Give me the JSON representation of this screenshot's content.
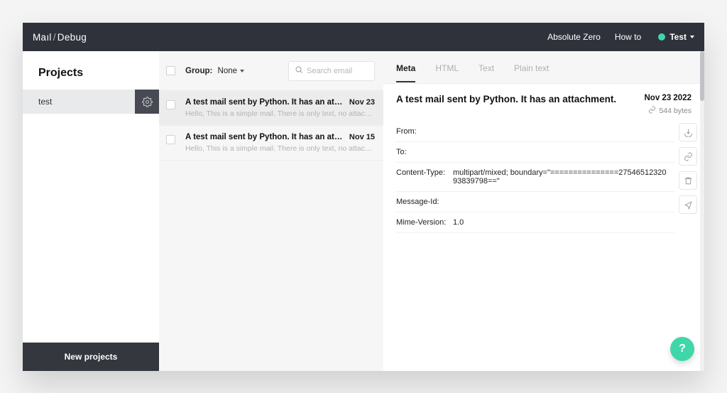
{
  "header": {
    "brand_a": "Maıl",
    "brand_sep": "/",
    "brand_b": "Debug",
    "nav": {
      "absolute_zero": "Absolute Zero",
      "how_to": "How to"
    },
    "user": "Test"
  },
  "sidebar": {
    "title": "Projects",
    "project_name": "test",
    "new_button": "New projects"
  },
  "list": {
    "group_label": "Group:",
    "group_value": "None",
    "search_placeholder": "Search email",
    "items": [
      {
        "subject": "A test mail sent by Python. It has an attachment.",
        "date": "Nov 23",
        "snippet": "Hello, This is a simple mail. There is only text, no attachments are there The mail...",
        "selected": true
      },
      {
        "subject": "A test mail sent by Python. It has an attachment.",
        "date": "Nov 15",
        "snippet": "Hello, This is a simple mail. There is only text, no attachments are there The mail...",
        "selected": false
      }
    ]
  },
  "tabs": {
    "meta": "Meta",
    "html": "HTML",
    "text": "Text",
    "plain": "Plain text"
  },
  "detail": {
    "title": "A test mail sent by Python. It has an attachment.",
    "date": "Nov 23 2022",
    "size": "544 bytes",
    "meta": [
      {
        "key": "From:",
        "value": ""
      },
      {
        "key": "To:",
        "value": ""
      },
      {
        "key": "Content-Type:",
        "value": "multipart/mixed; boundary=\"===============2754651232093839798==\""
      },
      {
        "key": "Message-Id:",
        "value": ""
      },
      {
        "key": "Mime-Version:",
        "value": "1.0"
      }
    ]
  },
  "help": "?"
}
